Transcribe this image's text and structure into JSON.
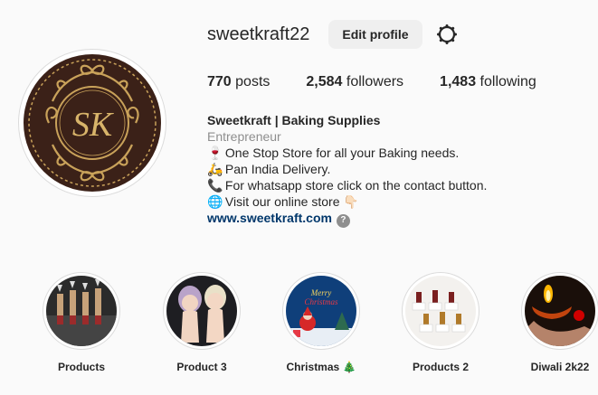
{
  "profile": {
    "username": "sweetkraft22",
    "edit_label": "Edit profile",
    "avatar_monogram": "SK"
  },
  "stats": [
    {
      "count": "770",
      "label": "posts"
    },
    {
      "count": "2,584",
      "label": "followers"
    },
    {
      "count": "1,483",
      "label": "following"
    }
  ],
  "bio": {
    "name": "Sweetkraft | Baking Supplies",
    "category": "Entrepreneur",
    "lines": [
      {
        "icon": "🍷",
        "text": "One Stop Store for all your Baking needs."
      },
      {
        "icon": "🛵",
        "text": "Pan India Delivery."
      },
      {
        "icon": "📞",
        "text": "For whatsapp store click on the contact button."
      },
      {
        "icon": "🌐",
        "text": "Visit our online store 👇🏻"
      }
    ],
    "link": "www.sweetkraft.com",
    "link_help": "?"
  },
  "highlights": [
    {
      "label": "Products"
    },
    {
      "label": "Product 3"
    },
    {
      "label": "Christmas 🎄",
      "art_text_1": "Merry",
      "art_text_2": "Christmas"
    },
    {
      "label": "Products 2"
    },
    {
      "label": "Diwali 2k22"
    }
  ],
  "colors": {
    "avatar_bg": "#3b2118",
    "gold": "#c9a25a",
    "link": "#00376b",
    "secondary_text": "#8e8e8e"
  }
}
